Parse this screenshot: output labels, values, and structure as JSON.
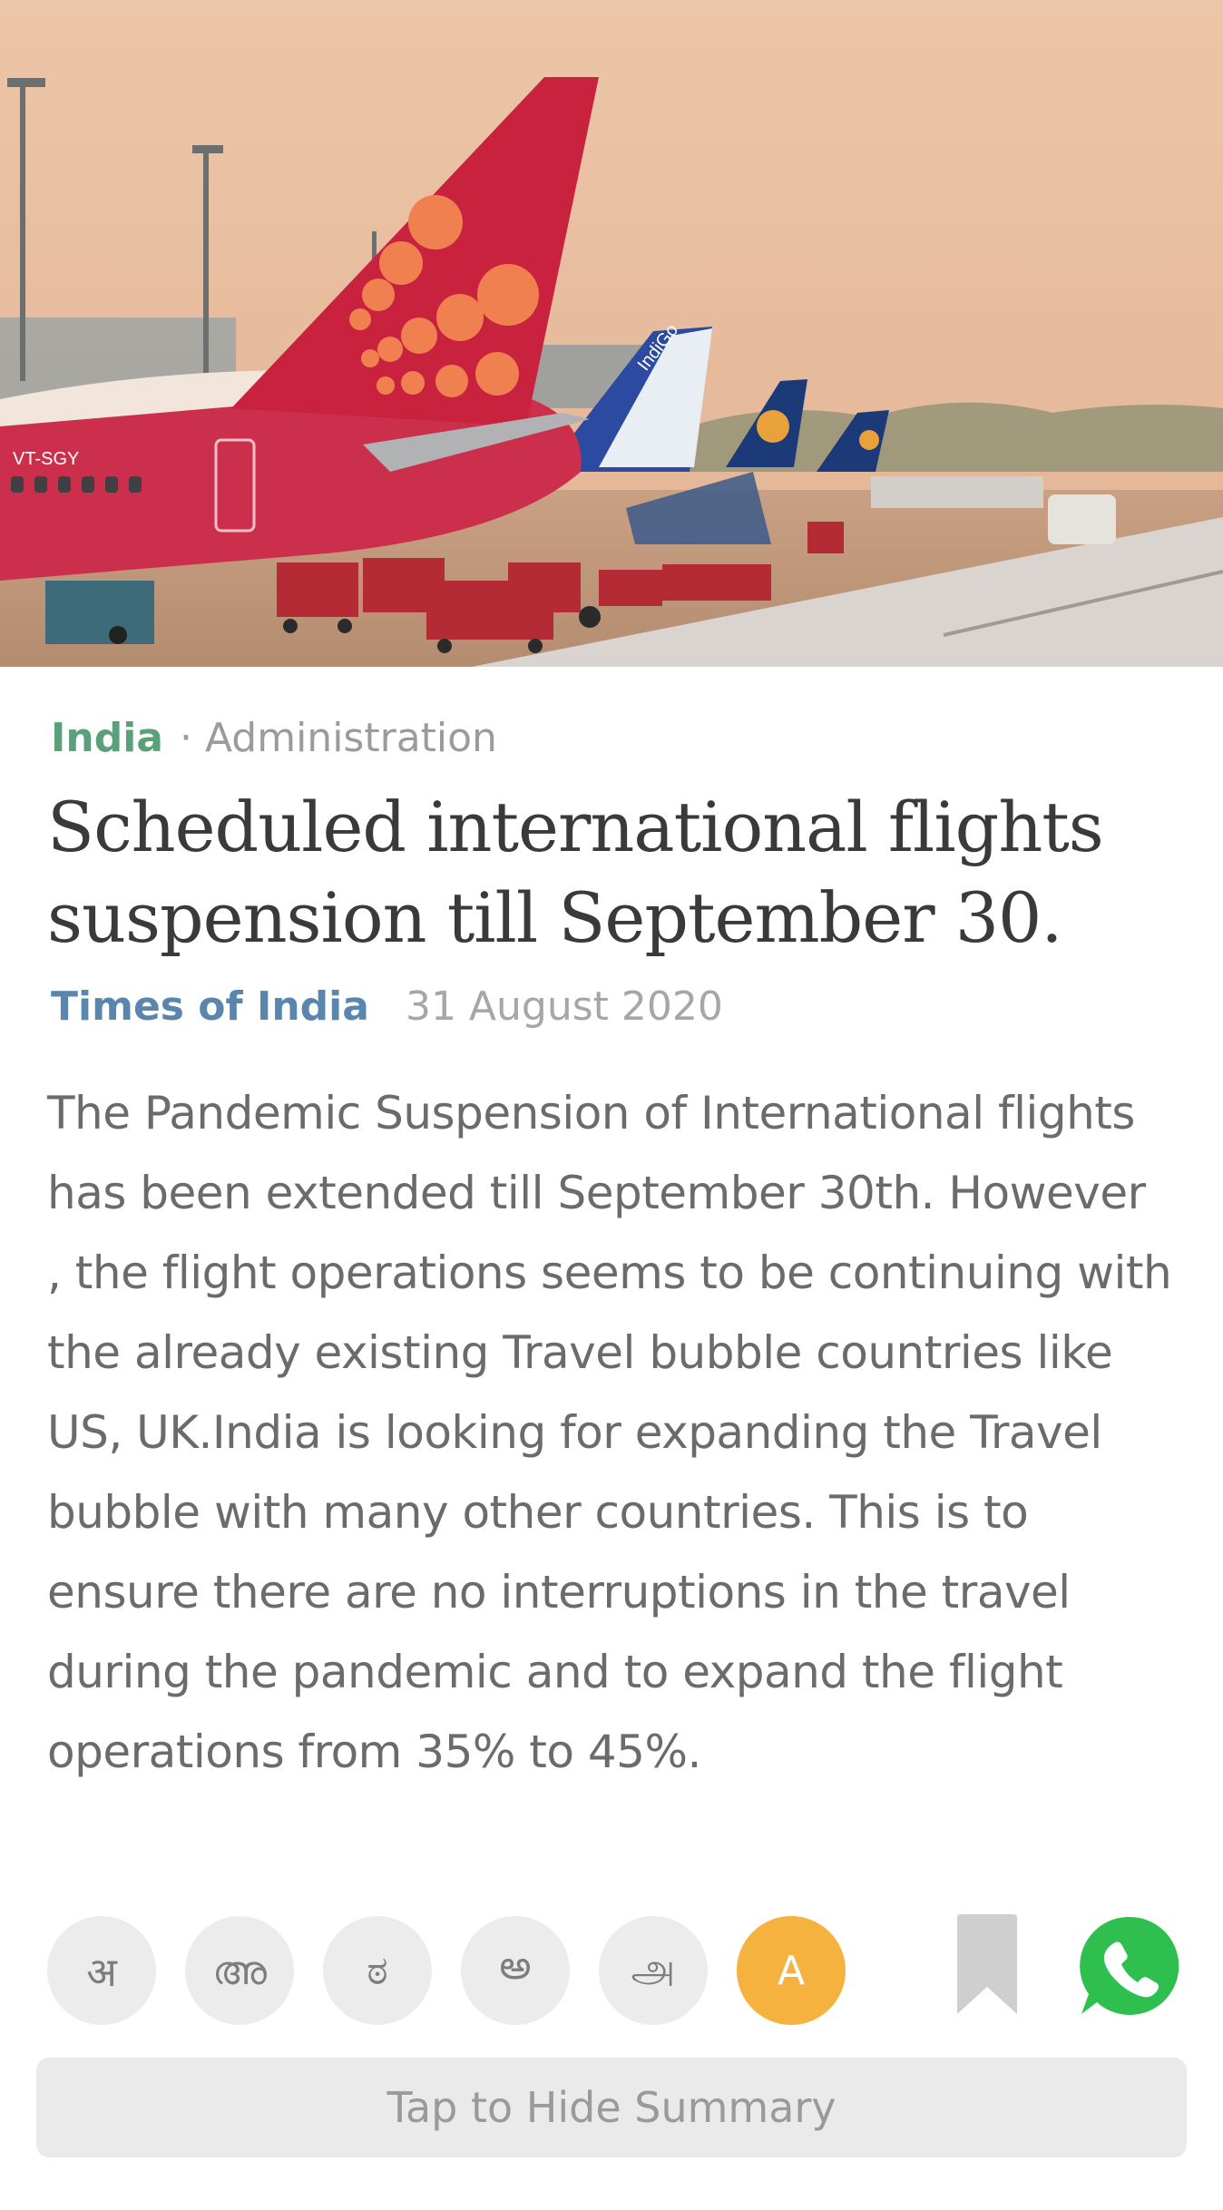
{
  "article": {
    "category": "India",
    "separator": "·",
    "subcategory": "Administration",
    "headline": "Scheduled international flights suspension till September 30.",
    "source": "Times of India",
    "date": "31 August 2020",
    "summary": "The Pandemic Suspension of International flights has been extended till September 30th. However , the flight operations seems to be continuing with the already existing Travel bubble countries like US, UK.India is looking for expanding the Travel bubble with many other countries. This is to ensure there are no interruptions in the travel during the pandemic and to expand the flight operations from 35% to 45%."
  },
  "hero_image": {
    "description_icon": "airport-tarmac-image",
    "tail_registration": "VT-SGY",
    "tail_airline_text": "IndiGo"
  },
  "languages": [
    {
      "label": "अ",
      "active": false
    },
    {
      "label": "അ",
      "active": false
    },
    {
      "label": "ಠ",
      "active": false
    },
    {
      "label": "అ",
      "active": false
    },
    {
      "label": "அ",
      "active": false
    },
    {
      "label": "A",
      "active": true
    }
  ],
  "actions": {
    "bookmark_icon": "bookmark-icon",
    "share_icon": "whatsapp-icon",
    "hide_summary_label": "Tap to Hide Summary"
  },
  "colors": {
    "category": "#5aa07a",
    "source": "#5a86ad",
    "active_language": "#f6b23e",
    "whatsapp": "#2fbf4f"
  }
}
